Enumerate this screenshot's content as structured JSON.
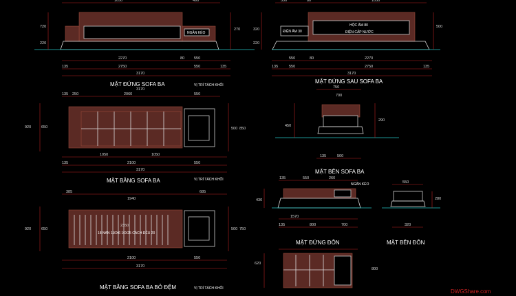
{
  "views": {
    "front": {
      "title": "MẶT ĐỨNG SOFA BA"
    },
    "back": {
      "title": "MẶT ĐỨNG SAU SOFA BA"
    },
    "side": {
      "title": "MẶT BÊN SOFA BA"
    },
    "plan": {
      "title": "MẶT BẰNG SOFA BA"
    },
    "plan_no_cushion": {
      "title": "MẶT BẰNG SOFA BA BỎ ĐỆM"
    },
    "stool_front": {
      "title": "MẶT ĐỨNG ĐÔN"
    },
    "stool_side": {
      "title": "MẶT BÊN ĐÔN"
    }
  },
  "labels": {
    "drawer": "NGĂN KÉO",
    "hoc_am": "HỘC ÂM 80",
    "dien_am": "ĐIỆN ÂM 30",
    "dien_cap_nuoc": "ĐIỆN CẤP NƯỚC",
    "vi_tri": "VỊ TRÍ TÁCH KHỐI",
    "slats": "18 NAN 110X6 10X25 CÁCH ĐỀU 20"
  },
  "dims": {
    "d2270": "2270",
    "d2750": "2750",
    "d3170": "3170",
    "d550": "550",
    "d135": "135",
    "d80": "80",
    "d1940": "1940",
    "d2350": "2350",
    "d2100": "2100",
    "d1050": "1050",
    "d2060": "2060",
    "d250": "250",
    "d750": "750",
    "d500": "500",
    "d1570": "1570",
    "d800": "800",
    "d260": "260",
    "d700": "700",
    "d385": "385",
    "d685": "685",
    "d920": "920",
    "d650": "650",
    "d850": "850",
    "d150": "150",
    "d720": "720",
    "d320": "320",
    "d290": "290",
    "d450": "450",
    "d220": "220",
    "d620": "620",
    "d270": "270",
    "d210": "210",
    "d430": "430",
    "d280": "280",
    "d25": "25",
    "d35": "35"
  },
  "watermark": "DWGShare.com"
}
